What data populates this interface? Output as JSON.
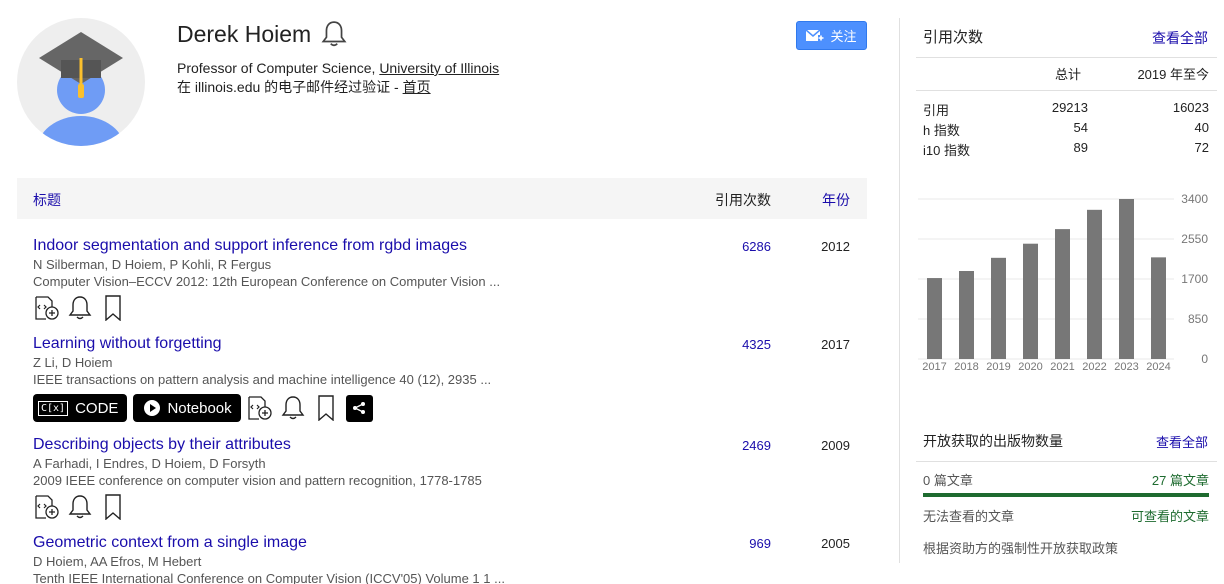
{
  "profile": {
    "name": "Derek Hoiem",
    "affiliation_prefix": "Professor of Computer Science, ",
    "affiliation_org": "University of Illinois",
    "email_verified": "在 illinois.edu 的电子邮件经过验证 - ",
    "homepage_link": "首页",
    "follow_label": "关注"
  },
  "table": {
    "col_title": "标题",
    "col_cited": "引用次数",
    "col_year": "年份"
  },
  "articles": [
    {
      "title": "Indoor segmentation and support inference from rgbd images",
      "authors": "N Silberman, D Hoiem, P Kohli, R Fergus",
      "venue": "Computer Vision–ECCV 2012: 12th European Conference on Computer Vision ...",
      "cites": "6286",
      "year": "2012"
    },
    {
      "title": "Learning without forgetting",
      "authors": "Z Li, D Hoiem",
      "venue": "IEEE transactions on pattern analysis and machine intelligence 40 (12), 2935 ...",
      "cites": "4325",
      "year": "2017",
      "code_label": "CODE",
      "notebook_label": "Notebook"
    },
    {
      "title": "Describing objects by their attributes",
      "authors": "A Farhadi, I Endres, D Hoiem, D Forsyth",
      "venue": "2009 IEEE conference on computer vision and pattern recognition, 1778-1785",
      "cites": "2469",
      "year": "2009"
    },
    {
      "title": "Geometric context from a single image",
      "authors": "D Hoiem, AA Efros, M Hebert",
      "venue": "Tenth IEEE International Conference on Computer Vision (ICCV'05) Volume 1 1 ...",
      "cites": "969",
      "year": "2005"
    }
  ],
  "citations": {
    "title": "引用次数",
    "view_all": "查看全部",
    "col_total": "总计",
    "col_since": "2019 年至今",
    "rows": [
      {
        "label": "引用",
        "total": "29213",
        "since": "16023"
      },
      {
        "label": "h 指数",
        "total": "54",
        "since": "40"
      },
      {
        "label": "i10 指数",
        "total": "89",
        "since": "72"
      }
    ]
  },
  "chart_data": {
    "type": "bar",
    "categories": [
      "2017",
      "2018",
      "2019",
      "2020",
      "2021",
      "2022",
      "2023",
      "2024"
    ],
    "values": [
      1720,
      1870,
      2150,
      2450,
      2760,
      3170,
      3400,
      2160
    ],
    "yticks": [
      "3400",
      "2550",
      "1700",
      "850",
      "0"
    ],
    "ylim": [
      0,
      3400
    ],
    "bar_color": "#777777",
    "grid": true
  },
  "open_access": {
    "title": "开放获取的出版物数量",
    "view_all": "查看全部",
    "unavailable_count": "0 篇文章",
    "available_count": "27 篇文章",
    "unavailable_label": "无法查看的文章",
    "available_label": "可查看的文章",
    "policy_note": "根据资助方的强制性开放获取政策"
  }
}
